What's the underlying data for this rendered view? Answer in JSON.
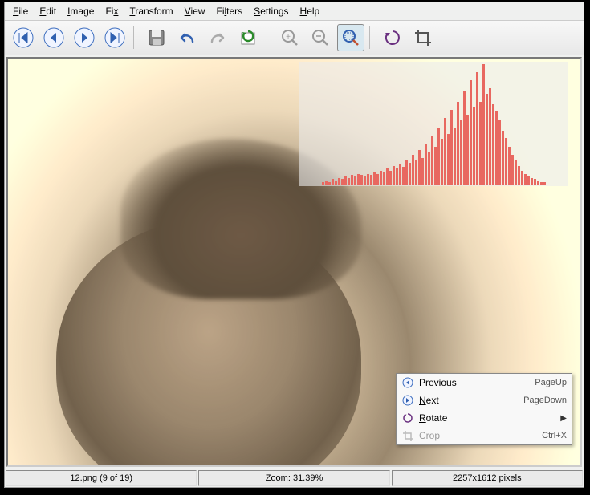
{
  "menu": {
    "file": "File",
    "edit": "Edit",
    "image": "Image",
    "fix": "Fix",
    "transform": "Transform",
    "view": "View",
    "filters": "Filters",
    "settings": "Settings",
    "help": "Help"
  },
  "context": {
    "previous": "Previous",
    "previous_key": "PageUp",
    "next": "Next",
    "next_key": "PageDown",
    "rotate": "Rotate",
    "crop": "Crop",
    "crop_key": "Ctrl+X"
  },
  "status": {
    "file": "12.png (9 of 19)",
    "zoom": "Zoom: 31.39%",
    "dims": "2257x1612 pixels"
  },
  "histogram": [
    2,
    3,
    2,
    4,
    3,
    5,
    4,
    6,
    5,
    7,
    6,
    8,
    7,
    6,
    8,
    7,
    9,
    8,
    10,
    9,
    12,
    10,
    14,
    12,
    15,
    13,
    18,
    16,
    22,
    18,
    26,
    20,
    30,
    24,
    36,
    28,
    42,
    34,
    50,
    38,
    56,
    42,
    62,
    48,
    70,
    52,
    78,
    58,
    84,
    62,
    90,
    68,
    72,
    60,
    55,
    48,
    40,
    35,
    28,
    22,
    18,
    14,
    10,
    8,
    6,
    5,
    4,
    3,
    2,
    2
  ]
}
